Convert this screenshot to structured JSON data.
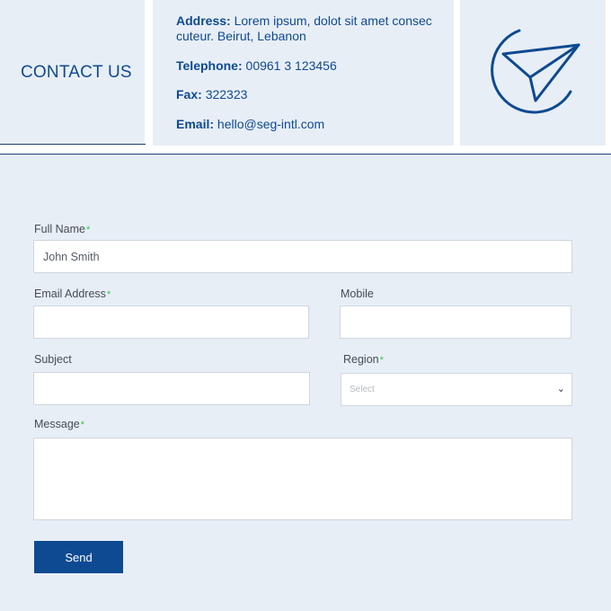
{
  "header": {
    "title": "CONTACT US",
    "address_label": "Address:",
    "address_value": "Lorem ipsum, dolot sit amet consec cuteur. Beirut, Lebanon",
    "telephone_label": "Telephone:",
    "telephone_value": "00961 3 123456",
    "fax_label": "Fax:",
    "fax_value": "322323",
    "email_label": "Email:",
    "email_value": "hello@seg-intl.com",
    "icon": "paper-plane-icon"
  },
  "form": {
    "required_mark": "*",
    "full_name": {
      "label": "Full Name",
      "placeholder": "John Smith",
      "value": ""
    },
    "email": {
      "label": "Email Address",
      "placeholder": "",
      "value": ""
    },
    "mobile": {
      "label": "Mobile",
      "placeholder": "",
      "value": ""
    },
    "subject": {
      "label": "Subject",
      "placeholder": "",
      "value": ""
    },
    "region": {
      "label": "Region",
      "selected": "Select"
    },
    "message": {
      "label": "Message",
      "placeholder": "",
      "value": ""
    },
    "send_label": "Send"
  },
  "colors": {
    "brand_blue": "#0d4a91",
    "panel_bg": "#e8eef6",
    "required_green": "#2ecc40"
  }
}
